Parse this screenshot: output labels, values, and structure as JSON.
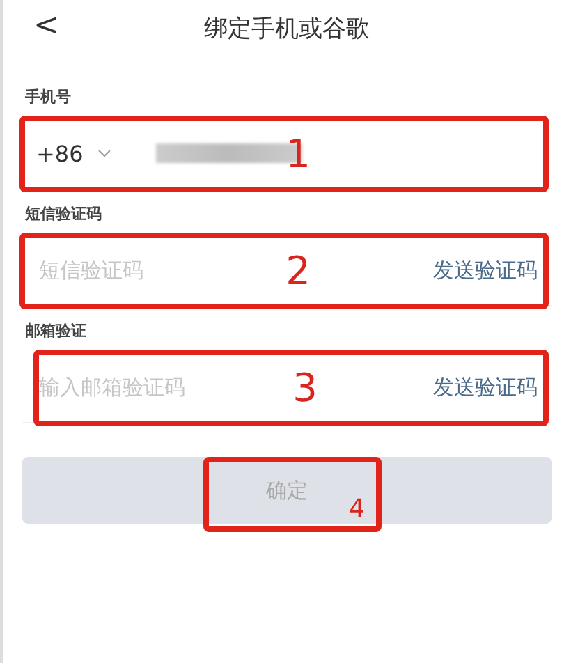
{
  "header": {
    "back": "<",
    "title": "绑定手机或谷歌"
  },
  "fields": [
    {
      "kind": "phone",
      "label": "手机号",
      "prefix": "+86",
      "marker": "1"
    },
    {
      "kind": "code",
      "label": "短信验证码",
      "placeholder": "短信验证码",
      "action": "发送验证码",
      "marker": "2"
    },
    {
      "kind": "code",
      "label": "邮箱验证",
      "placeholder": "输入邮箱验证码",
      "action": "发送验证码",
      "marker": "3"
    }
  ],
  "confirm": {
    "label": "确定",
    "disabled": true,
    "marker": "4"
  }
}
